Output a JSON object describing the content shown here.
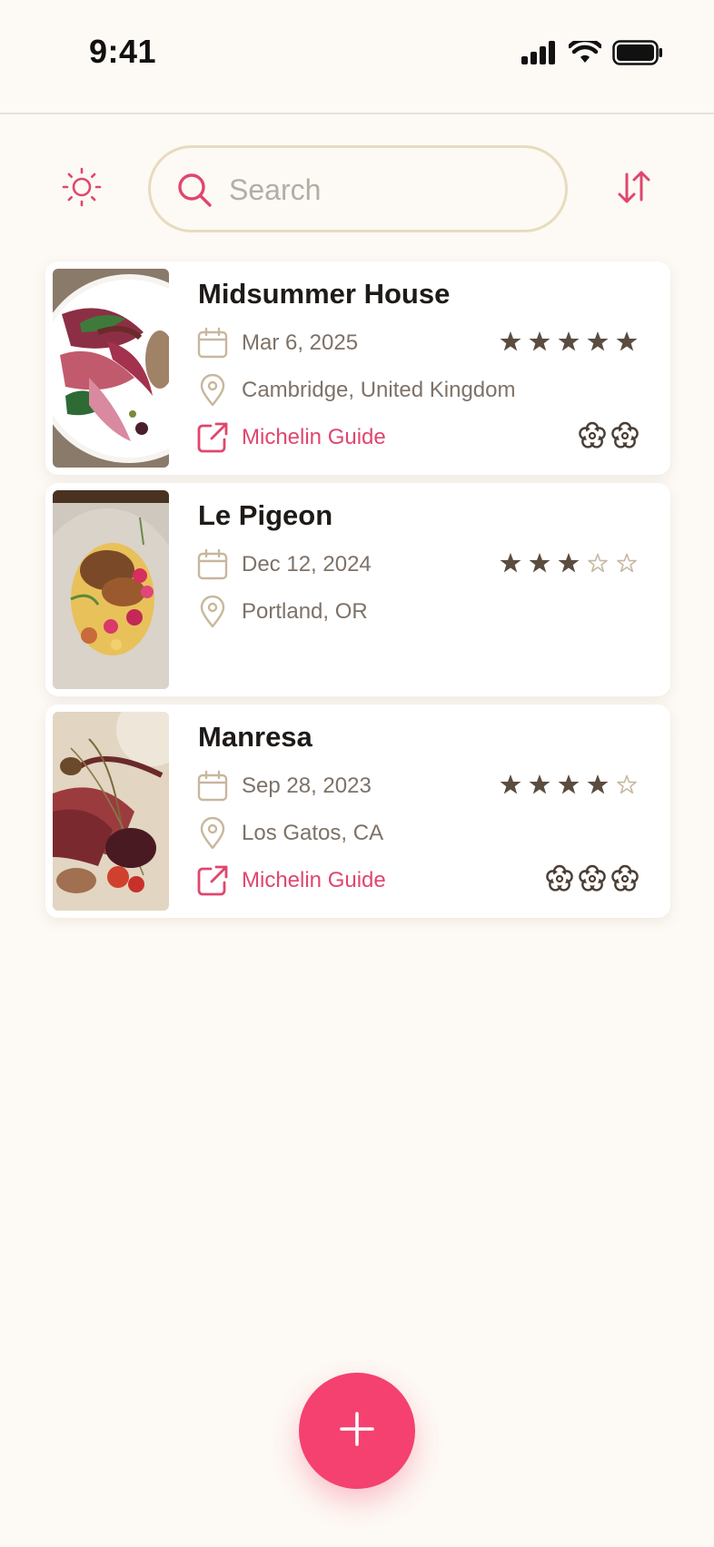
{
  "status_bar": {
    "time": "9:41"
  },
  "search": {
    "placeholder": "Search",
    "value": ""
  },
  "restaurants": [
    {
      "name": "Midsummer House",
      "date": "Mar 6, 2025",
      "location": "Cambridge, United Kingdom",
      "rating": 5,
      "link_label": "Michelin Guide",
      "michelin_stars": 2
    },
    {
      "name": "Le Pigeon",
      "date": "Dec 12, 2024",
      "location": "Portland, OR",
      "rating": 3,
      "link_label": "",
      "michelin_stars": 0
    },
    {
      "name": "Manresa",
      "date": "Sep 28, 2023",
      "location": "Los Gatos, CA",
      "rating": 4,
      "link_label": "Michelin Guide",
      "michelin_stars": 3
    }
  ],
  "colors": {
    "accent": "#f4416f",
    "background": "#fdf9f4",
    "star_filled": "#5b4c40",
    "star_empty": "#c7b8a3",
    "muted_text": "#7e7268"
  }
}
